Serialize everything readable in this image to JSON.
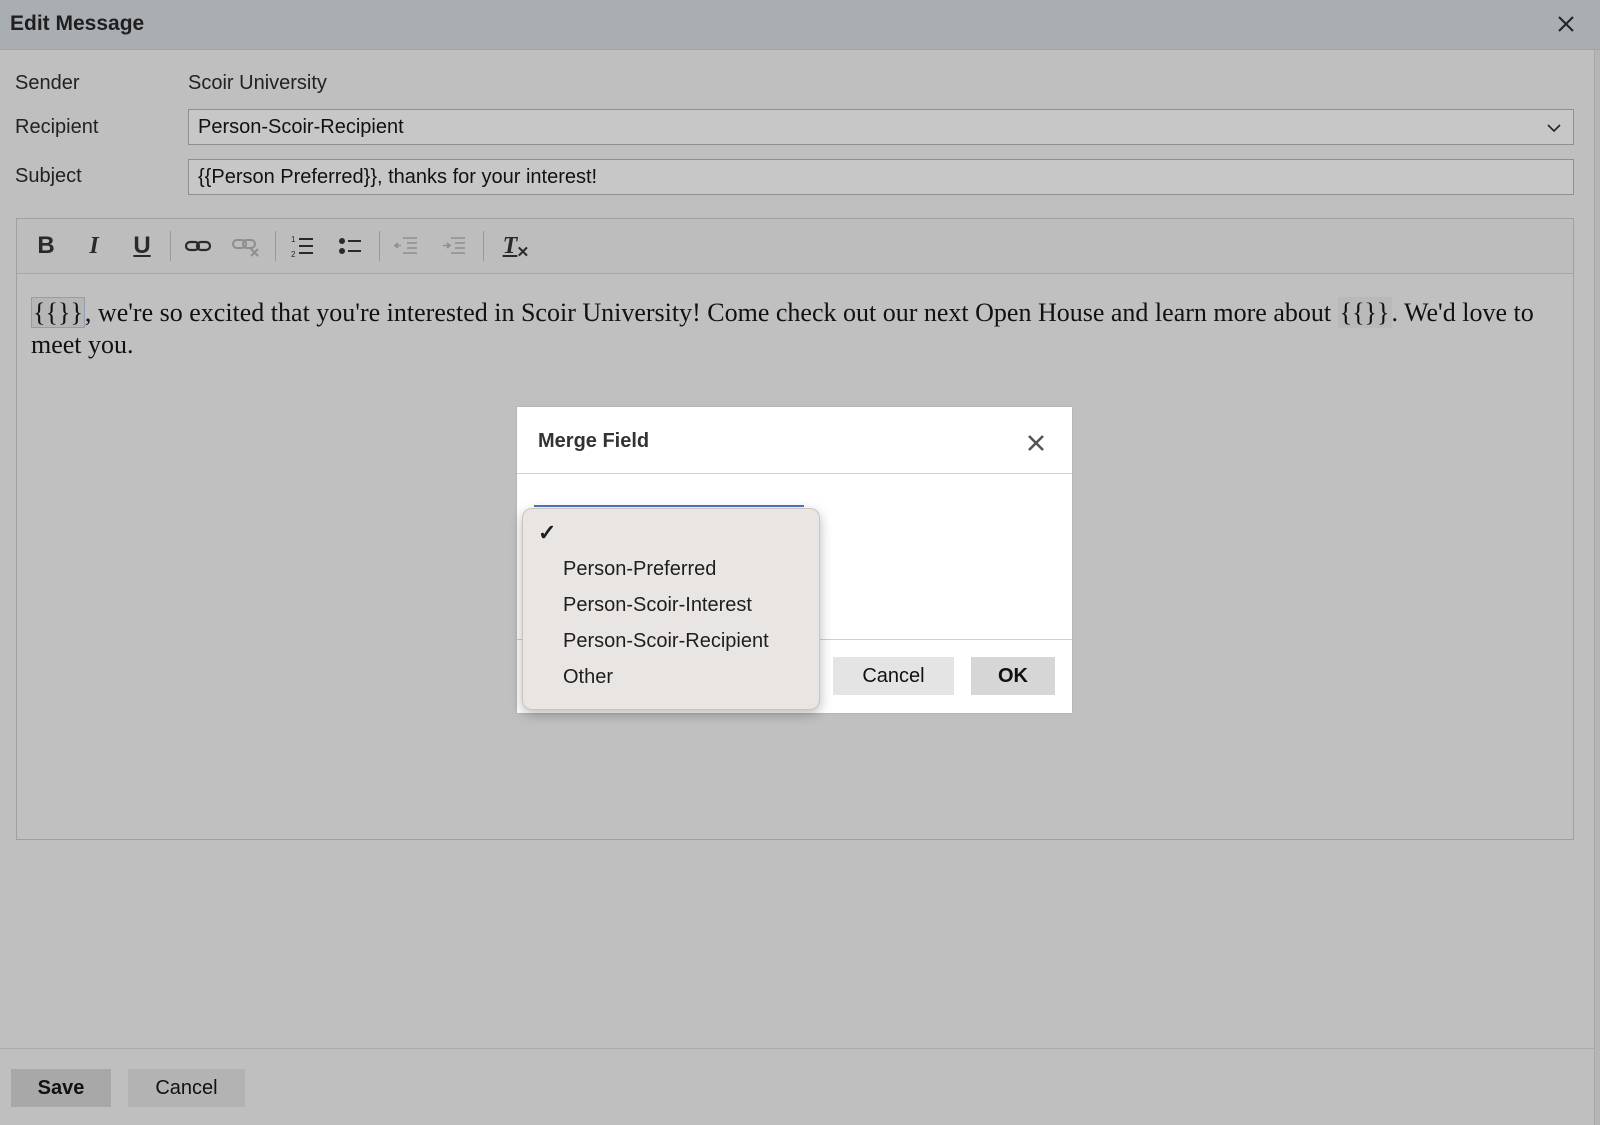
{
  "window": {
    "title": "Edit Message"
  },
  "form": {
    "sender_label": "Sender",
    "sender_value": "Scoir University",
    "recipient_label": "Recipient",
    "recipient_value": "Person-Scoir-Recipient",
    "subject_label": "Subject",
    "subject_value": "{{Person Preferred}}, thanks for your interest!"
  },
  "toolbar": {
    "bold": "B",
    "italic": "I",
    "underline": "U",
    "clear_format": "T"
  },
  "editor": {
    "token1": "{{}}",
    "text1": ", we're so excited that you're interested in Scoir University! Come check out our next Open House and learn more about ",
    "token2": "{{}}",
    "text2": ". We'd love to meet you."
  },
  "footer": {
    "save_label": "Save",
    "cancel_label": "Cancel"
  },
  "merge_dialog": {
    "title": "Merge Field",
    "cancel_label": "Cancel",
    "ok_label": "OK",
    "selected_option": "",
    "options": [
      "",
      "Person-Preferred",
      "Person-Scoir-Interest",
      "Person-Scoir-Recipient",
      "Other"
    ],
    "check_mark": "✓"
  }
}
